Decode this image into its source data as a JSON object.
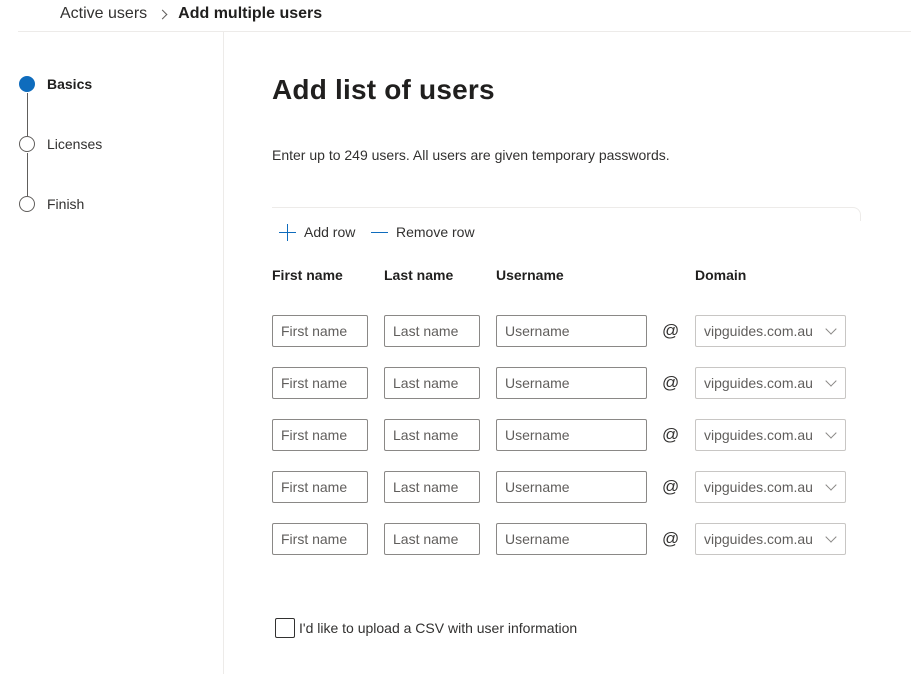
{
  "breadcrumb": {
    "parent": "Active users",
    "current": "Add multiple users"
  },
  "stepper": {
    "steps": [
      {
        "label": "Basics",
        "active": true
      },
      {
        "label": "Licenses",
        "active": false
      },
      {
        "label": "Finish",
        "active": false
      }
    ]
  },
  "main": {
    "title": "Add list of users",
    "description": "Enter up to 249 users. All users are given temporary passwords.",
    "add_row_label": "Add row",
    "remove_row_label": "Remove row",
    "columns": {
      "first": "First name",
      "last": "Last name",
      "username": "Username",
      "domain": "Domain"
    },
    "placeholders": {
      "first": "First name",
      "last": "Last name",
      "username": "Username"
    },
    "at_symbol": "@",
    "rows": [
      {
        "first": "",
        "last": "",
        "username": "",
        "domain": "vipguides.com.au"
      },
      {
        "first": "",
        "last": "",
        "username": "",
        "domain": "vipguides.com.au"
      },
      {
        "first": "",
        "last": "",
        "username": "",
        "domain": "vipguides.com.au"
      },
      {
        "first": "",
        "last": "",
        "username": "",
        "domain": "vipguides.com.au"
      },
      {
        "first": "",
        "last": "",
        "username": "",
        "domain": "vipguides.com.au"
      }
    ],
    "csv_option_label": "I'd like to upload a CSV with user information",
    "csv_checked": false
  },
  "colors": {
    "accent": "#0f6cbd",
    "border": "#8a8886",
    "divider": "#edebe9"
  }
}
